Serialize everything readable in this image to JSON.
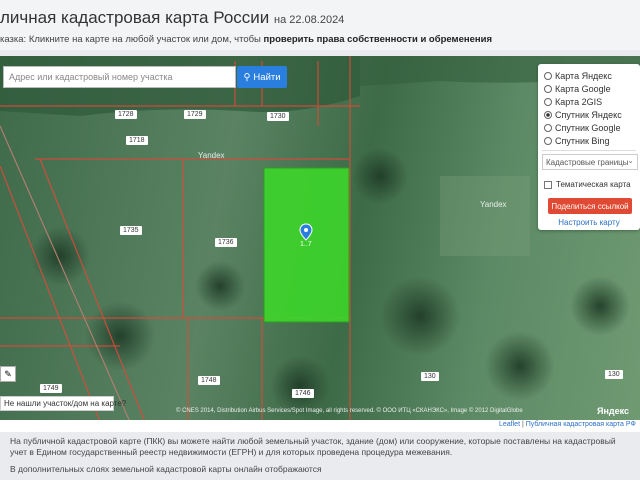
{
  "header": {
    "title": "личная кадастровая карта России",
    "date": "на 22.08.2024",
    "hint_prefix": "казка: Кликните на карте на любой участок или дом, чтобы ",
    "hint_bold": "проверить права собственности и обременения"
  },
  "search": {
    "placeholder": "Адрес или кадастровый номер участка",
    "button_label": "Найти"
  },
  "layers": {
    "items": [
      {
        "label": "Карта Яндекс",
        "selected": false
      },
      {
        "label": "Карта Google",
        "selected": false
      },
      {
        "label": "Карта 2GIS",
        "selected": false
      },
      {
        "label": "Спутник Яндекс",
        "selected": true
      },
      {
        "label": "Спутник Google",
        "selected": false
      },
      {
        "label": "Спутник Bing",
        "selected": false
      }
    ],
    "boundaries_select": "Кадастровые границы",
    "thematic_label": "Тематическая карта",
    "share_button": "Поделиться ссылкой",
    "setup_link": "Настроить карту"
  },
  "map": {
    "plot_labels": [
      "1728",
      "1729",
      "1730",
      "1718",
      "1735",
      "1736",
      "1749",
      "1748",
      "1746",
      "130",
      "130"
    ],
    "selected_plot_label": "1..7",
    "watermark_1": "Yandex",
    "watermark_2": "Yandex",
    "not_found_label": "Не нашли участок/дом на карте?",
    "copyright": "© CNES 2014, Distribution Airbus Services/Spot Image, all rights reserved. © ООО ИТЦ «СКАНЭКС», Image © 2012 DigitalGlobe",
    "logo": "Яндекс",
    "selected_color": "#3dd62a"
  },
  "attribution": {
    "leaflet": "Leaflet",
    "separator": " | ",
    "pkk": "Публичная кадастровая карта РФ"
  },
  "info": {
    "paragraph_1": "На публичной кадастровой карте (ПКК) вы можете найти любой земельный участок, здание (дом) или сооружение, которые поставлены на кадастровый учет в Едином государственный реестр недвижимости (ЕГРН) и для которых проведена процедура межевания.",
    "paragraph_2": "В дополнительных слоях земельной кадастровой карты онлайн отображаются"
  }
}
